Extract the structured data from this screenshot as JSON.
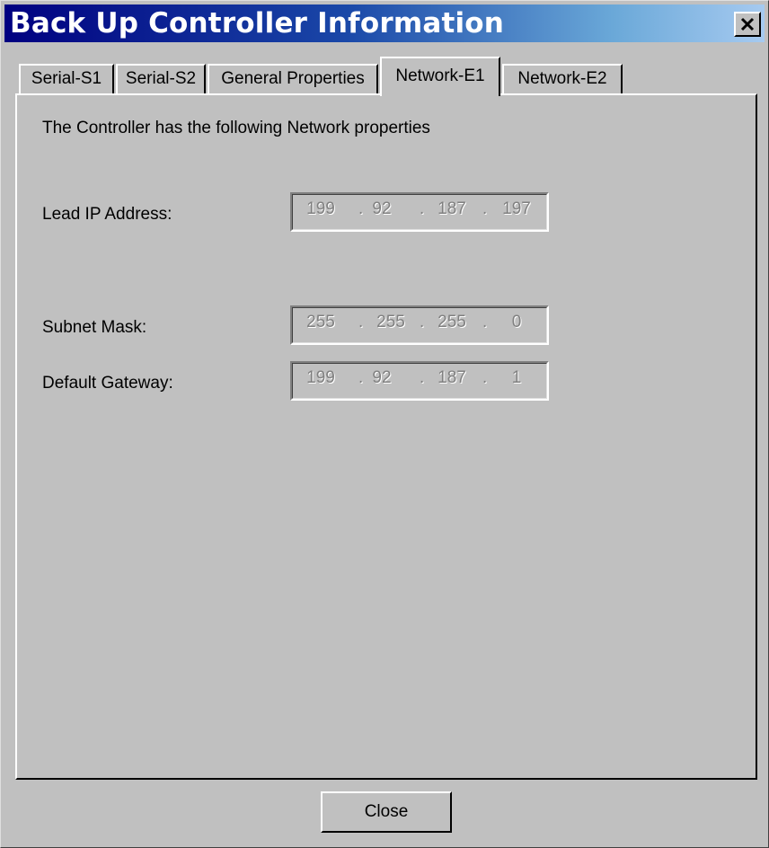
{
  "window": {
    "title": "Back Up Controller Information",
    "close_icon": "close-x-icon"
  },
  "tabs": [
    {
      "label": "Serial-S1",
      "active": false
    },
    {
      "label": "Serial-S2",
      "active": false
    },
    {
      "label": "General Properties",
      "active": false
    },
    {
      "label": "Network-E1",
      "active": true
    },
    {
      "label": "Network-E2",
      "active": false
    }
  ],
  "panel": {
    "heading": "The Controller has the following Network properties",
    "fields": [
      {
        "label": "Lead IP Address:",
        "octets": [
          "199",
          "92",
          "187",
          "197"
        ],
        "enabled": false
      },
      {
        "label": "Subnet Mask:",
        "octets": [
          "255",
          "255",
          "255",
          "0"
        ],
        "enabled": false
      },
      {
        "label": "Default Gateway:",
        "octets": [
          "199",
          "92",
          "187",
          "1"
        ],
        "enabled": false
      }
    ]
  },
  "footer": {
    "close_label": "Close"
  },
  "colors": {
    "title_gradient_start": "#000080",
    "title_gradient_end": "#a6caf0",
    "face": "#c0c0c0",
    "disabled_text": "#808080"
  }
}
